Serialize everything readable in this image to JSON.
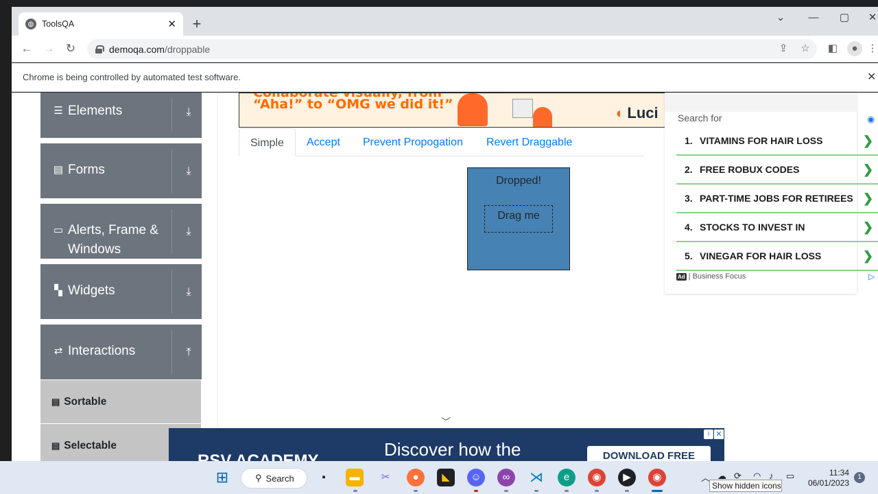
{
  "browser": {
    "tab_title": "ToolsQA",
    "url_host": "demoqa.com",
    "url_path": "/droppable",
    "infobar": "Chrome is being controlled by automated test software."
  },
  "sidebar": {
    "groups": [
      {
        "label": "Elements",
        "icon": "hamburger-icon",
        "arrow": "download-arrow-icon"
      },
      {
        "label": "Forms",
        "icon": "form-icon",
        "arrow": "download-arrow-icon"
      },
      {
        "label": "Alerts, Frame &",
        "label2": "Windows",
        "icon": "window-icon",
        "arrow": "download-arrow-icon"
      },
      {
        "label": "Widgets",
        "icon": "widgets-icon",
        "arrow": "download-arrow-icon"
      },
      {
        "label": "Interactions",
        "icon": "interactions-icon",
        "arrow": "upload-arrow-icon"
      }
    ],
    "subitems": [
      "Sortable",
      "Selectable"
    ]
  },
  "ad_top": {
    "line1": "Collaborate visually, from",
    "line2": "“Aha!” to “OMG we did it!”",
    "brand": "Luci"
  },
  "tabs": [
    "Simple",
    "Accept",
    "Prevent Propogation",
    "Revert Draggable"
  ],
  "droppable": {
    "drop_text": "Dropped!",
    "drag_text": "Drag me",
    "drop_color": "#4682b4"
  },
  "ad_right": {
    "search_for": "Search for",
    "items": [
      {
        "num": "1.",
        "label": "VITAMINS FOR HAIR LOSS"
      },
      {
        "num": "2.",
        "label": "FREE ROBUX CODES"
      },
      {
        "num": "3.",
        "label": "PART-TIME JOBS FOR RETIREES"
      },
      {
        "num": "4.",
        "label": "STOCKS TO INVEST IN"
      },
      {
        "num": "5.",
        "label": "VINEGAR FOR HAIR LOSS"
      }
    ],
    "ad_tag": "Ad",
    "footer": "| Business Focus"
  },
  "ad_bottom": {
    "brand": "RSV ACADEMY",
    "headline": "Discover how the",
    "cta": "DOWNLOAD FREE"
  },
  "taskbar": {
    "search": "Search",
    "time": "11:34",
    "date": "06/01/2023",
    "notifications": "1",
    "tooltip": "Show hidden icons"
  }
}
